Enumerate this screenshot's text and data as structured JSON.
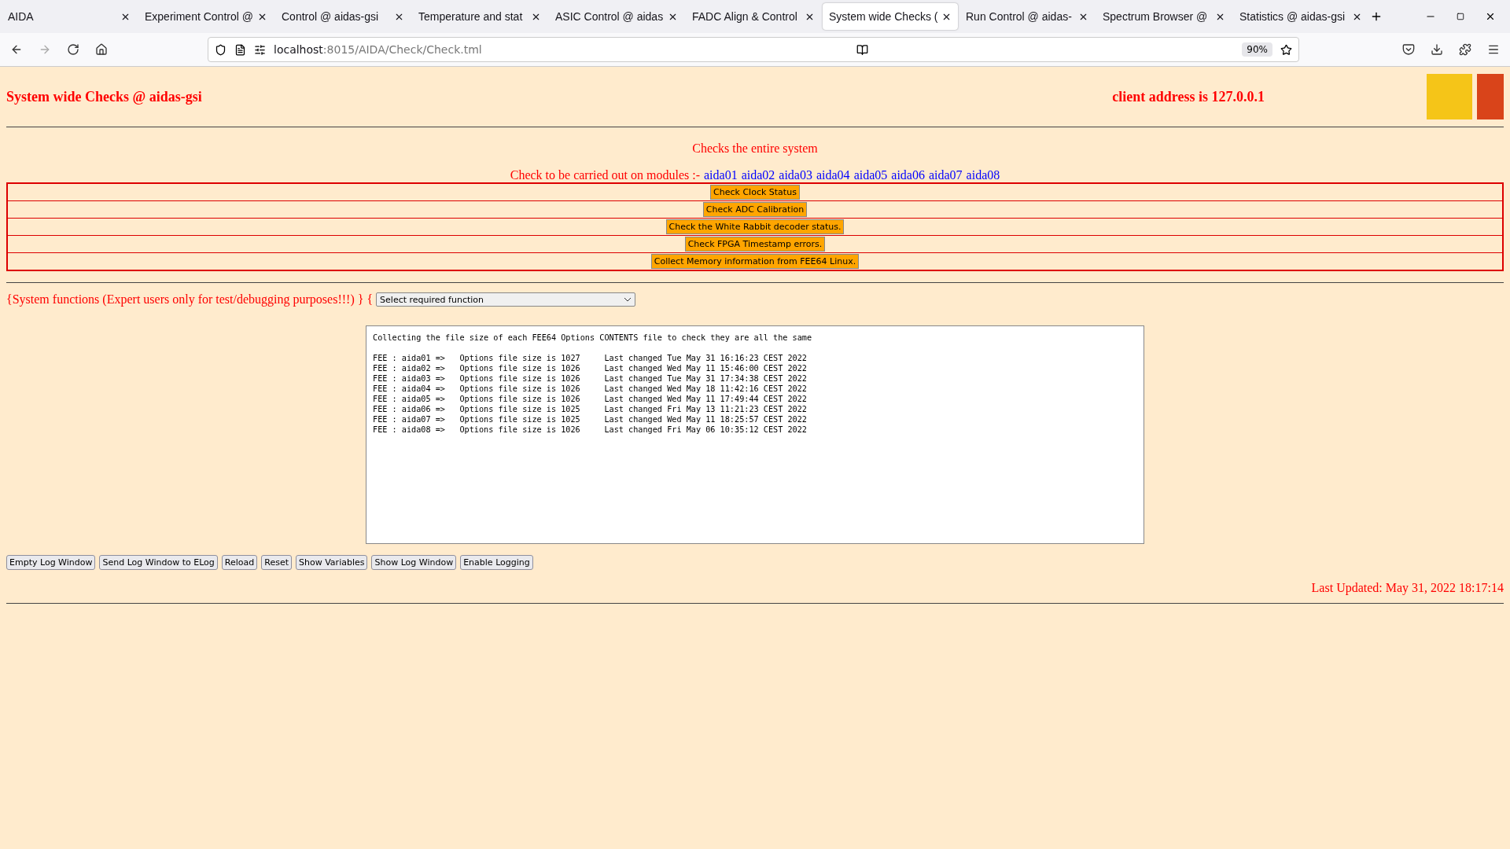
{
  "browser": {
    "tabs": [
      {
        "label": "AIDA",
        "selected": false
      },
      {
        "label": "Experiment Control @",
        "selected": false
      },
      {
        "label": "Control @ aidas-gsi",
        "selected": false
      },
      {
        "label": "Temperature and stat",
        "selected": false
      },
      {
        "label": "ASIC Control @ aidas",
        "selected": false
      },
      {
        "label": "FADC Align & Control",
        "selected": false
      },
      {
        "label": "System wide Checks (",
        "selected": true
      },
      {
        "label": "Run Control @ aidas-",
        "selected": false
      },
      {
        "label": "Spectrum Browser @",
        "selected": false
      },
      {
        "label": "Statistics @ aidas-gsi",
        "selected": false
      }
    ],
    "url": {
      "host": "localhost",
      "rest": ":8015/AIDA/Check/Check.tml"
    },
    "zoom": "90%"
  },
  "header": {
    "title": "System wide Checks @ aidas-gsi",
    "client_address": "client address is 127.0.0.1"
  },
  "checks": {
    "subtitle": "Checks the entire system",
    "modules_prefix": "Check to be carried out on modules :-",
    "modules": [
      "aida01",
      "aida02",
      "aida03",
      "aida04",
      "aida05",
      "aida06",
      "aida07",
      "aida08"
    ],
    "buttons": [
      "Check Clock Status",
      "Check ADC Calibration",
      "Check the White Rabbit decoder status.",
      "Check FPGA Timestamp errors.",
      "Collect Memory information from FEE64 Linux."
    ]
  },
  "system_functions": {
    "label": "{System functions (Expert users only for test/debugging purposes!!!)  } {",
    "select": "Select required function"
  },
  "log": {
    "intro": "Collecting the file size of each FEE64 Options CONTENTS file to check they are all the same",
    "lines": [
      "FEE : aida01 =>   Options file size is 1027     Last changed Tue May 31 16:16:23 CEST 2022",
      "FEE : aida02 =>   Options file size is 1026     Last changed Wed May 11 15:46:00 CEST 2022",
      "FEE : aida03 =>   Options file size is 1026     Last changed Tue May 31 17:34:38 CEST 2022",
      "FEE : aida04 =>   Options file size is 1026     Last changed Wed May 18 11:42:16 CEST 2022",
      "FEE : aida05 =>   Options file size is 1026     Last changed Wed May 11 17:49:44 CEST 2022",
      "FEE : aida06 =>   Options file size is 1025     Last changed Fri May 13 11:21:23 CEST 2022",
      "FEE : aida07 =>   Options file size is 1025     Last changed Wed May 11 18:25:57 CEST 2022",
      "FEE : aida08 =>   Options file size is 1026     Last changed Fri May 06 10:35:12 CEST 2022"
    ]
  },
  "log_buttons": [
    "Empty Log Window",
    "Send Log Window to ELog",
    "Reload",
    "Reset",
    "Show Variables",
    "Show Log Window",
    "Enable Logging"
  ],
  "last_updated": "Last Updated: May 31, 2022 18:17:14"
}
